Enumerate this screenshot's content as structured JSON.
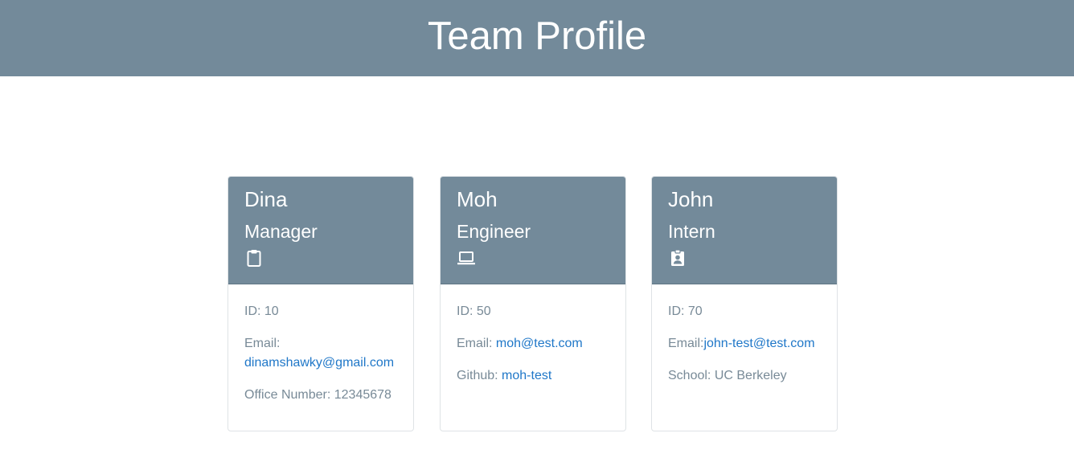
{
  "header": {
    "title": "Team Profile"
  },
  "colors": {
    "header_bg": "#738a9a",
    "card_header_bg": "#738a9a",
    "body_text": "#788a97",
    "link": "#1f77c8"
  },
  "team": [
    {
      "name": "Dina",
      "role": "Manager",
      "icon": "clipboard-icon",
      "id_text": "ID: 10",
      "email_label": "Email:",
      "email": "dinamshawky@gmail.com",
      "extra_label": "Office Number: 12345678",
      "extra_value": ""
    },
    {
      "name": "Moh",
      "role": "Engineer",
      "icon": "laptop-icon",
      "id_text": "ID: 50",
      "email_label": "Email:",
      "email": "moh@test.com",
      "extra_label": "Github:",
      "extra_value": "moh-test"
    },
    {
      "name": "John",
      "role": "Intern",
      "icon": "badge-icon",
      "id_text": "ID: 70",
      "email_label": "Email:",
      "email": "john-test@test.com",
      "extra_label": "School: UC Berkeley",
      "extra_value": ""
    }
  ]
}
